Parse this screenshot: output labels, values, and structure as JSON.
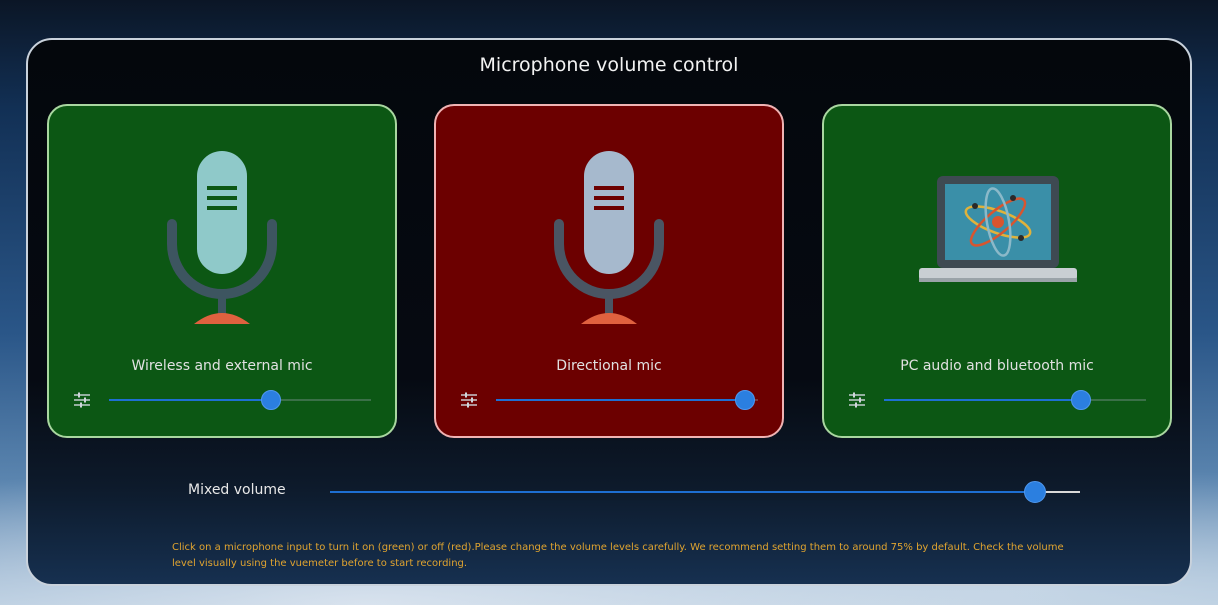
{
  "title": "Microphone volume control",
  "inputs": [
    {
      "label": "Wireless and external mic",
      "state": "on",
      "volume": 0.62,
      "icon": "microphone-icon"
    },
    {
      "label": "Directional mic",
      "state": "off",
      "volume": 0.95,
      "icon": "microphone-icon"
    },
    {
      "label": "PC audio and bluetooth mic",
      "state": "on",
      "volume": 0.75,
      "icon": "laptop-icon"
    }
  ],
  "mixed": {
    "label": "Mixed volume",
    "volume": 0.94
  },
  "hint": "Click on a microphone input to turn it on (green) or off (red).Please change the volume levels carefully. We recommend setting them to around 75% by default. Check the volume level visually using the vuemeter before to start recording.",
  "colors": {
    "on": "#0c5714",
    "off": "#6c0000",
    "accent": "#2b7fe0",
    "hint": "#e0a430"
  }
}
